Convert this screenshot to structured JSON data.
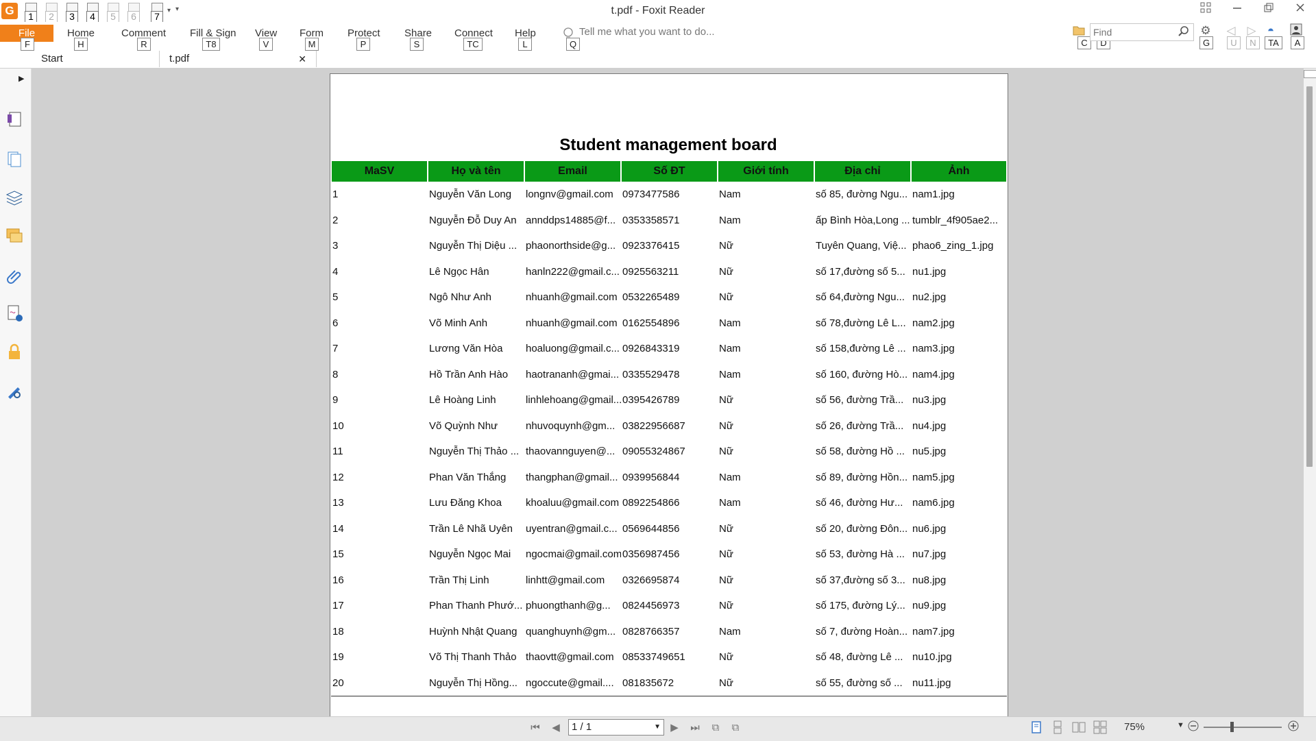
{
  "window": {
    "title": "t.pdf - Foxit Reader",
    "app_icon": "G",
    "controls": [
      "restore-grid-icon",
      "minimize-icon",
      "restore-icon",
      "close-icon"
    ]
  },
  "quick_access": [
    {
      "key": "1",
      "icon": "open-folder-icon",
      "dim": false
    },
    {
      "key": "2",
      "icon": "save-icon",
      "dim": true
    },
    {
      "key": "3",
      "icon": "print-icon",
      "dim": false
    },
    {
      "key": "4",
      "icon": "new-doc-icon",
      "dim": false
    },
    {
      "key": "5",
      "icon": "undo-icon",
      "dim": true
    },
    {
      "key": "6",
      "icon": "redo-icon",
      "dim": true
    },
    {
      "key": "7",
      "icon": "hand-tool-icon",
      "dim": false
    }
  ],
  "ribbon": {
    "tabs": [
      {
        "label": "File",
        "key": "F"
      },
      {
        "label": "Home",
        "key": "H"
      },
      {
        "label": "Comment",
        "key": "R"
      },
      {
        "label": "Fill & Sign",
        "key": "T8"
      },
      {
        "label": "View",
        "key": "V"
      },
      {
        "label": "Form",
        "key": "M"
      },
      {
        "label": "Protect",
        "key": "P"
      },
      {
        "label": "Share",
        "key": "S"
      },
      {
        "label": "Connect",
        "key": "TC"
      },
      {
        "label": "Help",
        "key": "L"
      }
    ],
    "tell_me": {
      "placeholder": "Tell me what you want to do...",
      "key": "Q"
    },
    "find": {
      "placeholder": "Find",
      "key_c": "C",
      "key_d": "D"
    },
    "right_keys": [
      "G",
      "U",
      "N",
      "TA",
      "A"
    ]
  },
  "doc_tabs": [
    {
      "label": "Start"
    },
    {
      "label": "t.pdf",
      "close": "✕"
    }
  ],
  "sidebar": {
    "icons": [
      "pages-icon",
      "thumbnails-icon",
      "layers-icon",
      "comments-icon",
      "attachments-icon",
      "signatures-icon",
      "security-icon",
      "pen-tools-icon"
    ]
  },
  "document": {
    "title": "Student management board",
    "columns": [
      "MaSV",
      "Họ và tên",
      "Email",
      "Số ĐT",
      "Giới tính",
      "Địa chỉ",
      "Ảnh"
    ],
    "rows": [
      [
        "1",
        "Nguyễn Văn Long",
        "longnv@gmail.com",
        "0973477586",
        "Nam",
        "số 85, đường Ngu...",
        "nam1.jpg"
      ],
      [
        "2",
        "Nguyễn Đỗ Duy An",
        "annddps14885@f...",
        "0353358571",
        "Nam",
        "ấp Bình Hòa,Long ...",
        "tumblr_4f905ae2..."
      ],
      [
        "3",
        "Nguyễn Thị Diệu ...",
        "phaonorthside@g...",
        "0923376415",
        "Nữ",
        "Tuyên Quang, Việ...",
        "phao6_zing_1.jpg"
      ],
      [
        "4",
        "Lê Ngọc Hân",
        "hanln222@gmail.c...",
        "0925563211",
        "Nữ",
        "số 17,đường số 5...",
        "nu1.jpg"
      ],
      [
        "5",
        "Ngô Như Anh",
        "nhuanh@gmail.com",
        "0532265489",
        "Nữ",
        "số 64,đường Ngu...",
        "nu2.jpg"
      ],
      [
        "6",
        "Võ Minh Anh",
        "nhuanh@gmail.com",
        "0162554896",
        "Nam",
        "số 78,đường Lê L...",
        "nam2.jpg"
      ],
      [
        "7",
        "Lương Văn Hòa",
        "hoaluong@gmail.c...",
        "0926843319",
        "Nam",
        "số 158,đường Lê ...",
        "nam3.jpg"
      ],
      [
        "8",
        "Hồ Trần Anh Hào",
        "haotrananh@gmai...",
        "0335529478",
        "Nam",
        "số 160, đường Hò...",
        "nam4.jpg"
      ],
      [
        "9",
        "Lê Hoàng Linh",
        "linhlehoang@gmail...",
        "0395426789",
        "Nữ",
        "số 56, đường Trầ...",
        "nu3.jpg"
      ],
      [
        "10",
        "Võ Quỳnh Như",
        "nhuvoquynh@gm...",
        "03822956687",
        "Nữ",
        "số 26, đường Trầ...",
        "nu4.jpg"
      ],
      [
        "11",
        "Nguyễn Thị Thảo ...",
        "thaovannguyen@...",
        "09055324867",
        "Nữ",
        "số 58, đường Hồ ...",
        "nu5.jpg"
      ],
      [
        "12",
        "Phan Văn Thắng",
        "thangphan@gmail...",
        "0939956844",
        "Nam",
        "số 89, đường Hồn...",
        "nam5.jpg"
      ],
      [
        "13",
        "Lưu Đăng Khoa",
        "khoaluu@gmail.com",
        "0892254866",
        "Nam",
        "số 46, đường Hư...",
        "nam6.jpg"
      ],
      [
        "14",
        "Trần Lê Nhã Uyên",
        "uyentran@gmail.c...",
        "0569644856",
        "Nữ",
        "số 20, đường Đôn...",
        "nu6.jpg"
      ],
      [
        "15",
        "Nguyễn Ngọc Mai",
        "ngocmai@gmail.com",
        "0356987456",
        "Nữ",
        "số 53, đường Hà ...",
        "nu7.jpg"
      ],
      [
        "16",
        "Trần Thị Linh",
        "linhtt@gmail.com",
        "0326695874",
        "Nữ",
        "số 37,đường số 3...",
        "nu8.jpg"
      ],
      [
        "17",
        "Phan Thanh Phướ...",
        "phuongthanh@g...",
        "0824456973",
        "Nữ",
        "số 175, đường Lý...",
        "nu9.jpg"
      ],
      [
        "18",
        "Huỳnh Nhật Quang",
        "quanghuynh@gm...",
        "0828766357",
        "Nam",
        "số 7, đường Hoàn...",
        "nam7.jpg"
      ],
      [
        "19",
        "Võ Thị Thanh Thảo",
        "thaovtt@gmail.com",
        "08533749651",
        "Nữ",
        "số 48, đường Lê ...",
        "nu10.jpg"
      ],
      [
        "20",
        "Nguyễn Thị Hồng...",
        "ngoccute@gmail....",
        "081835672",
        "Nữ",
        "số 55, đường số ...",
        "nu11.jpg"
      ]
    ]
  },
  "statusbar": {
    "page_value": "1 / 1",
    "zoom": "75%"
  },
  "colors": {
    "accent": "#f0801a",
    "header_green": "#0a9a17",
    "canvas": "#d0d0d0"
  }
}
